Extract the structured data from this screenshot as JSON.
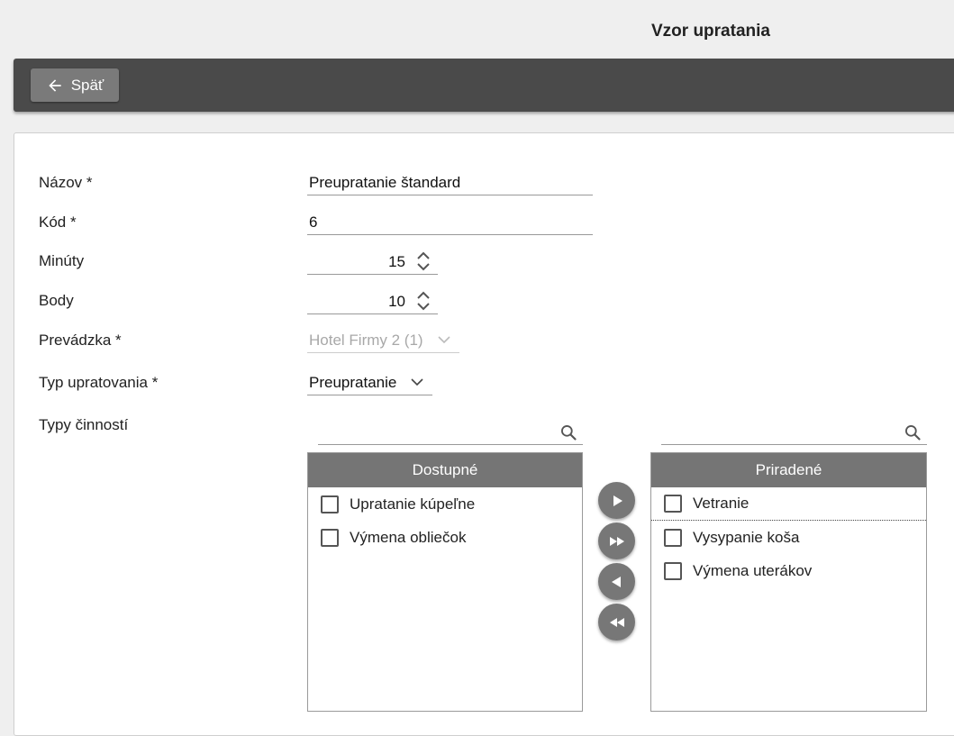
{
  "header": {
    "title": "Vzor upratania"
  },
  "toolbar": {
    "back_label": "Späť"
  },
  "form": {
    "name": {
      "label": "Názov *",
      "value": "Preupratanie štandard"
    },
    "code": {
      "label": "Kód *",
      "value": "6"
    },
    "minutes": {
      "label": "Minúty",
      "value": "15"
    },
    "points": {
      "label": "Body",
      "value": "10"
    },
    "facility": {
      "label": "Prevádzka *",
      "value": "Hotel Firmy 2 (1)",
      "disabled": true
    },
    "cleaning_type": {
      "label": "Typ upratovania *",
      "value": "Preupratanie"
    },
    "activity_types": {
      "label": "Typy činností"
    }
  },
  "available": {
    "header": "Dostupné",
    "items": [
      "Upratanie kúpeľne",
      "Výmena obliečok"
    ]
  },
  "assigned": {
    "header": "Priradené",
    "items": [
      "Vetranie",
      "Vysypanie koša",
      "Výmena uterákov"
    ]
  },
  "colors": {
    "toolbar": "#4a4a4a",
    "button": "#7a7a7a",
    "list_header": "#757575"
  },
  "icons": [
    "arrow-left-icon",
    "search-icon",
    "spinner-icon",
    "chevron-down-icon",
    "move-right-icon",
    "move-all-right-icon",
    "move-left-icon",
    "move-all-left-icon"
  ]
}
